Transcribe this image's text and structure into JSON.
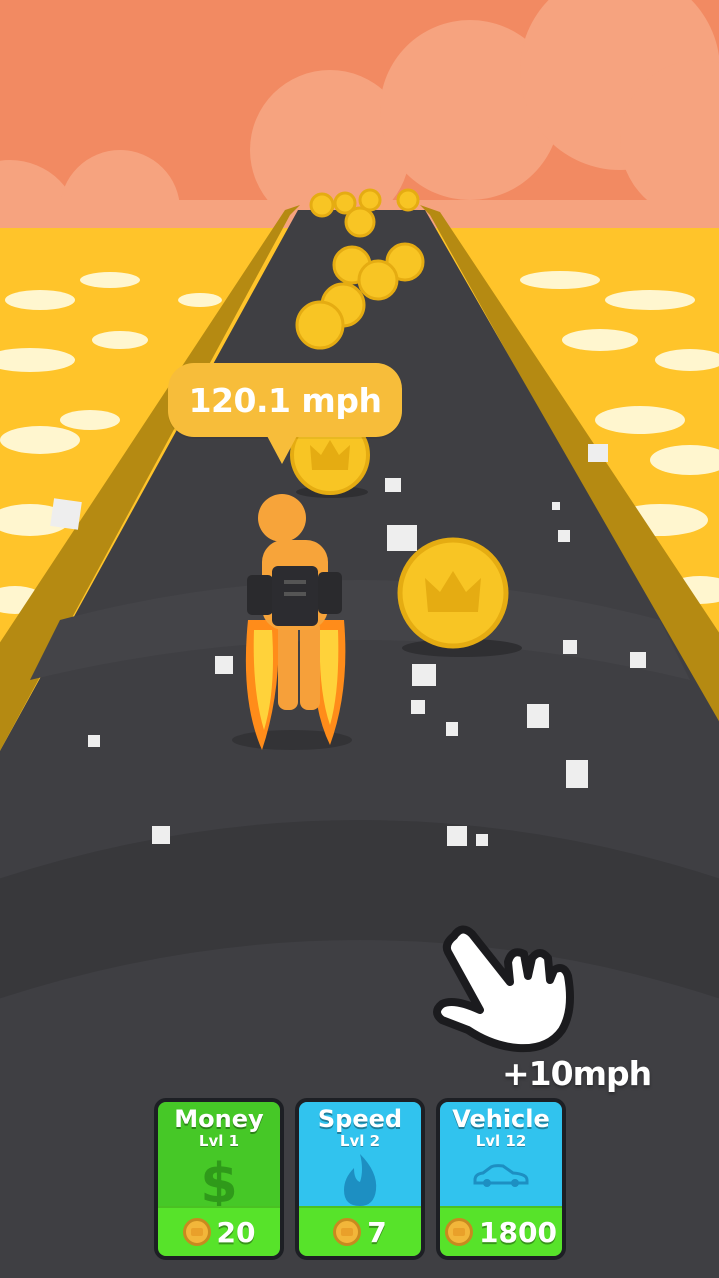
{
  "hud": {
    "speed_bubble": "120.1 mph",
    "boost_label": "+10mph"
  },
  "upgrades": [
    {
      "title": "Money",
      "level": "Lvl 1",
      "cost": "20",
      "icon": "dollar-sign-icon"
    },
    {
      "title": "Speed",
      "level": "Lvl 2",
      "cost": "7",
      "icon": "flame-icon"
    },
    {
      "title": "Vehicle",
      "level": "Lvl 12",
      "cost": "1800",
      "icon": "car-icon"
    }
  ],
  "colors": {
    "sky": "#f28a62",
    "sea": "#ffc42a",
    "road": "#3f3f43",
    "rail": "#b58a12",
    "coin": "#f8c524",
    "money_card": "#46c827",
    "speed_card": "#31c3ee",
    "vehicle_card": "#31c3ee",
    "cost_strip": "#57e32a"
  }
}
